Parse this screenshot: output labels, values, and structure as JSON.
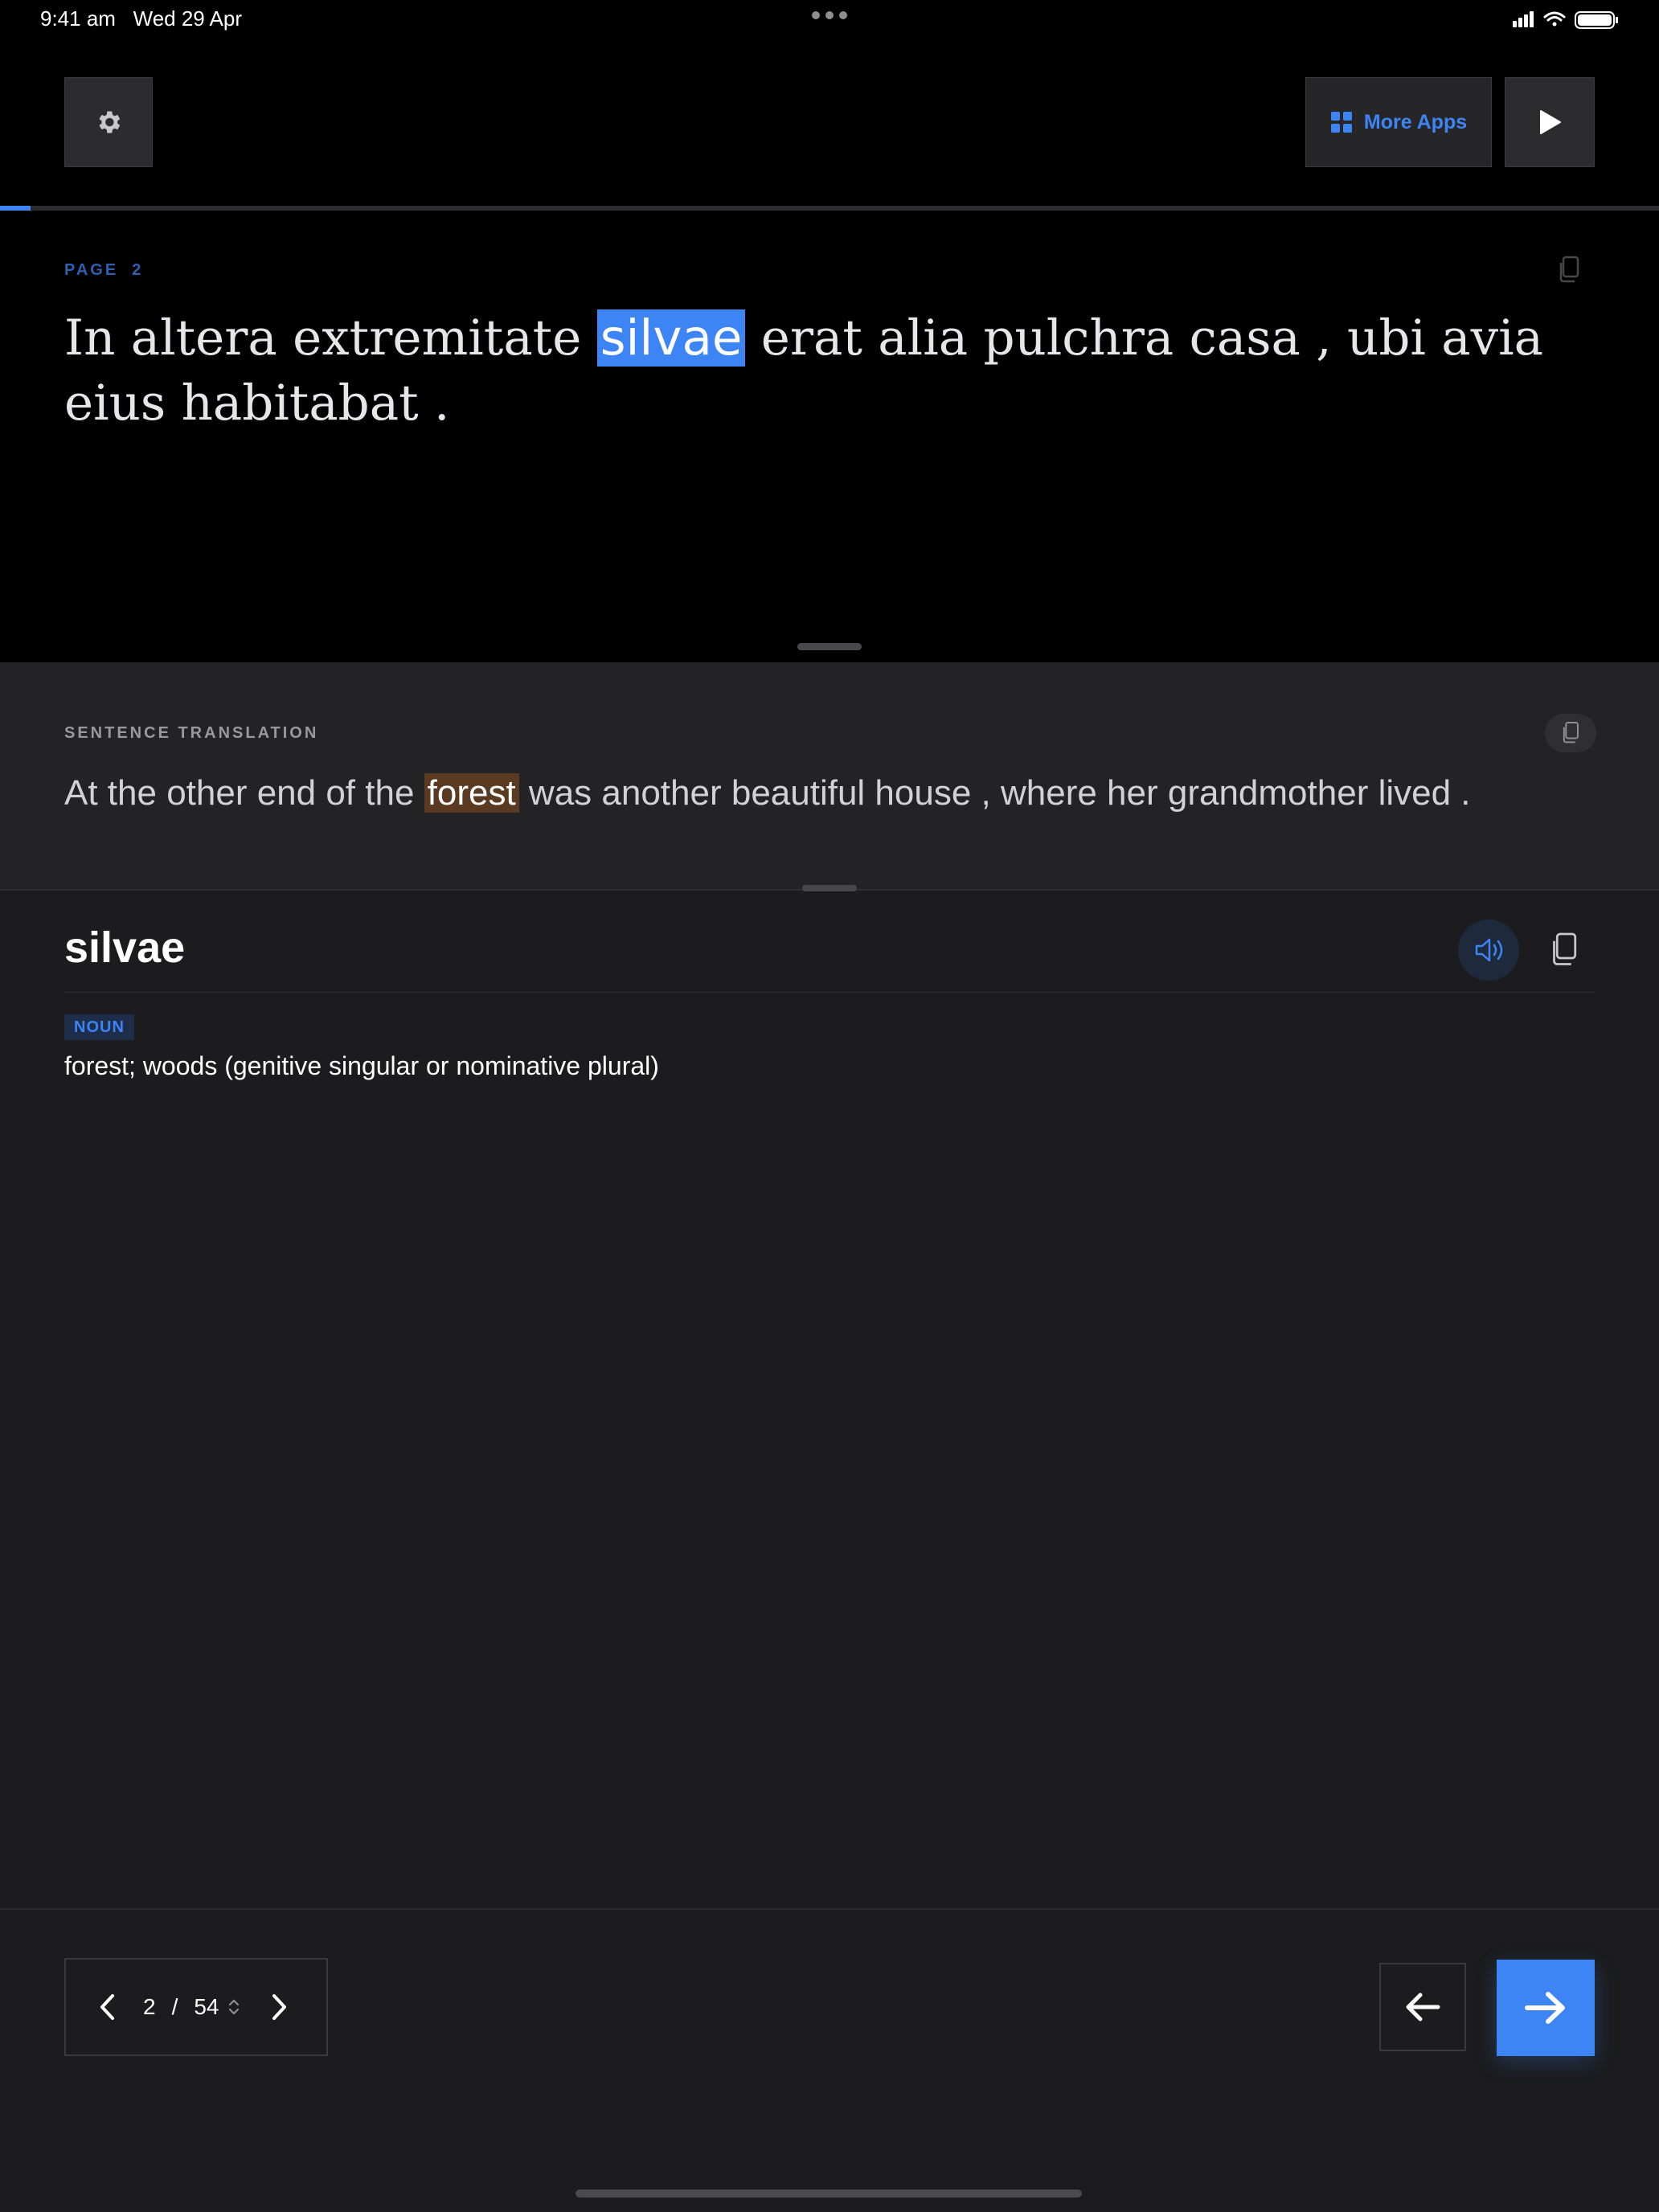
{
  "status_bar": {
    "time": "9:41 am",
    "date": "Wed 29 Apr"
  },
  "toolbar": {
    "settings_icon": "gear-icon",
    "more_apps_label": "More Apps",
    "more_apps_icon": "grid-icon",
    "play_icon": "play-icon"
  },
  "progress": {
    "current_page": 2,
    "total_pages": 54
  },
  "reading": {
    "page_label": "PAGE  2",
    "sentence_before": "In altera extremitate ",
    "highlighted_word": "silvae",
    "sentence_after": " erat alia pulchra casa , ubi avia eius habitabat ."
  },
  "translation": {
    "label": "SENTENCE TRANSLATION",
    "sentence_before": "At the other end of the ",
    "highlighted_word": "forest",
    "sentence_after": " was another beautiful house , where her grandmother lived ."
  },
  "word": {
    "headword": "silvae",
    "part_of_speech": "NOUN",
    "definition": "forest; woods (genitive singular or nominative plural)"
  },
  "pager": {
    "current": "2",
    "separator": "/",
    "total": "54"
  },
  "colors": {
    "accent": "#3d84f5",
    "translation_highlight": "#5a3b21",
    "background": "#1c1c1e"
  }
}
